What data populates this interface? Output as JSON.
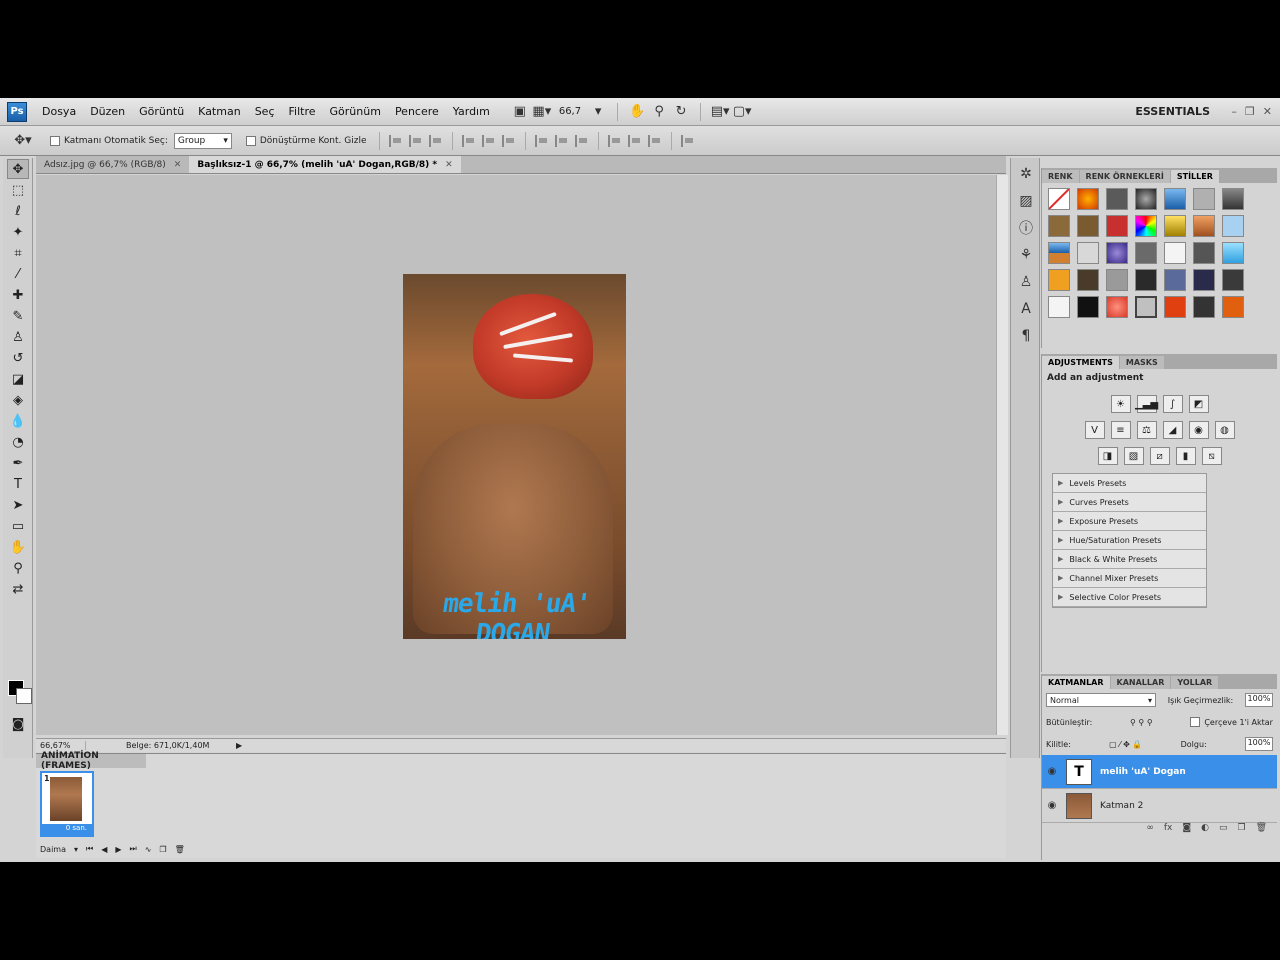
{
  "menu": [
    "Dosya",
    "Düzen",
    "Görüntü",
    "Katman",
    "Seç",
    "Filtre",
    "Görünüm",
    "Pencere",
    "Yardım"
  ],
  "menubar": {
    "logo": "Ps",
    "zoom": "66,7",
    "workspace": "ESSENTIALS"
  },
  "options": {
    "auto_select": "Katmanı Otomatik Seç:",
    "auto_select_value": "Group",
    "transform": "Dönüştürme Kont. Gizle"
  },
  "tabs": [
    {
      "label": "Adsız.jpg @ 66,7% (RGB/8)"
    },
    {
      "label": "Başlıksız-1 @ 66,7% (melih 'uA' Dogan,RGB/8) *"
    }
  ],
  "canvas": {
    "signature": "melih 'uA' DOGAN"
  },
  "status": {
    "zoom": "66,67%",
    "doc": "Belge: 671,0K/1,40M"
  },
  "animation": {
    "title": "ANİMATİON (FRAMES)",
    "frame_number": "1",
    "frame_time": "0 san.",
    "loop": "Daima"
  },
  "styles_panel": {
    "tabs": [
      "RENK",
      "RENK ÖRNEKLERİ",
      "STİLLER"
    ],
    "active": "STİLLER"
  },
  "adjustments_panel": {
    "tabs": [
      "ADJUSTMENTS",
      "MASKS"
    ],
    "title": "Add an adjustment",
    "presets": [
      "Levels Presets",
      "Curves Presets",
      "Exposure Presets",
      "Hue/Saturation Presets",
      "Black & White Presets",
      "Channel Mixer Presets",
      "Selective Color Presets"
    ]
  },
  "layers_panel": {
    "tabs": [
      "KATMANLAR",
      "KANALLAR",
      "YOLLAR"
    ],
    "blend_mode": "Normal",
    "opacity_label": "Işık Geçirmezlik:",
    "opacity": "100%",
    "unify_label": "Bütünleştir:",
    "propagate_label": "Çerçeve 1'i Aktar",
    "lock_label": "Kilitle:",
    "fill_label": "Dolgu:",
    "fill": "100%",
    "layers": [
      {
        "name": "melih 'uA' Dogan",
        "thumb": "T"
      },
      {
        "name": "Katman 2",
        "thumb": ""
      }
    ]
  },
  "colors": {
    "selection": "#3a8fe8",
    "signature": "#2aa8e8"
  }
}
